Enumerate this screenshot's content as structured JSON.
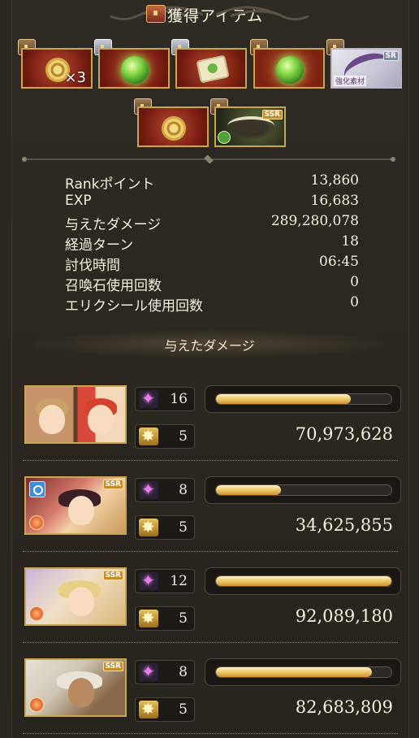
{
  "header": {
    "title": "獲得アイテム"
  },
  "items": [
    {
      "kind": "gear",
      "count": "×3"
    },
    {
      "kind": "green-orb"
    },
    {
      "kind": "scroll"
    },
    {
      "kind": "green-orb-2"
    },
    {
      "kind": "bow",
      "rarity": "SR",
      "label": "強化素材"
    },
    {
      "kind": "gear"
    },
    {
      "kind": "weapon",
      "rarity": "SSR"
    }
  ],
  "stats": [
    {
      "label": "Rankポイント",
      "value": "13,860"
    },
    {
      "label": "EXP",
      "value": "16,683"
    },
    {
      "label": "与えたダメージ",
      "value": "289,280,078"
    },
    {
      "label": "経過ターン",
      "value": "18"
    },
    {
      "label": "討伐時間",
      "value": "06:45"
    },
    {
      "label": "召喚石使用回数",
      "value": "0"
    },
    {
      "label": "エリクシール使用回数",
      "value": "0"
    }
  ],
  "damage_section": {
    "title": "与えたダメージ"
  },
  "characters": [
    {
      "skills": "16",
      "charge": "5",
      "damage": "70,973,628",
      "bar": 0.77
    },
    {
      "skills": "8",
      "charge": "5",
      "damage": "34,625,855",
      "bar": 0.37,
      "rarity": "SSR"
    },
    {
      "skills": "12",
      "charge": "5",
      "damage": "92,089,180",
      "bar": 1.0,
      "rarity": "SSR"
    },
    {
      "skills": "8",
      "charge": "5",
      "damage": "82,683,809",
      "bar": 0.89,
      "rarity": "SSR"
    }
  ]
}
